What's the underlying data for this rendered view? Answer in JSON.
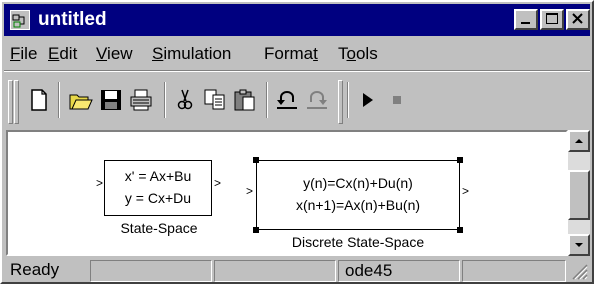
{
  "window": {
    "title": "untitled"
  },
  "menu": [
    {
      "pre": "",
      "u": "F",
      "post": "ile"
    },
    {
      "pre": "",
      "u": "E",
      "post": "dit"
    },
    {
      "pre": "",
      "u": "V",
      "post": "iew"
    },
    {
      "pre": "",
      "u": "S",
      "post": "imulation"
    },
    {
      "pre": "Forma",
      "u": "t",
      "post": ""
    },
    {
      "pre": "T",
      "u": "o",
      "post": "ols"
    }
  ],
  "toolbar": {
    "tools": [
      "new-icon",
      "open-icon",
      "save-icon",
      "print-icon",
      "cut-icon",
      "copy-icon",
      "paste-icon",
      "undo-icon",
      "redo-icon",
      "start-simulation-icon",
      "stop-simulation-icon"
    ]
  },
  "blocks": {
    "state_space": {
      "line1": "x' = Ax+Bu",
      "line2": "y = Cx+Du",
      "label": "State-Space"
    },
    "discrete_state_space": {
      "line1": "y(n)=Cx(n)+Du(n)",
      "line2": "x(n+1)=Ax(n)+Bu(n)",
      "label": "Discrete State-Space"
    }
  },
  "status": {
    "ready": "Ready",
    "pane1": "",
    "pane2": "",
    "solver": "ode45",
    "pane4": ""
  },
  "colors": {
    "titlebar": "#000080",
    "face": "#c0c0c0"
  }
}
